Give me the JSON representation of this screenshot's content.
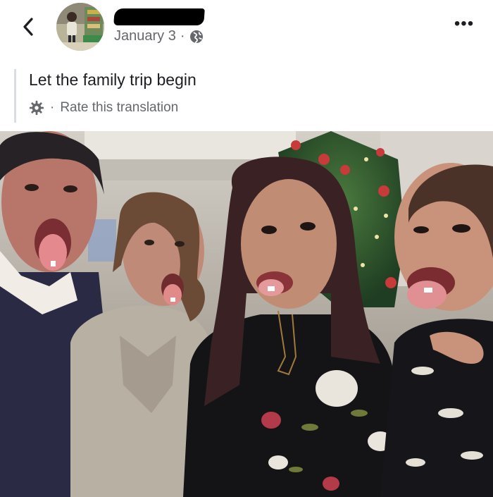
{
  "header": {
    "date": "January 3",
    "separator": "·",
    "privacy_icon": "globe-icon",
    "back_icon": "chevron-left-icon",
    "more_label": "•••"
  },
  "post": {
    "text": "Let the family trip begin",
    "translation": {
      "separator": "·",
      "link_label": "Rate this translation",
      "icon": "gear-icon"
    }
  },
  "photo": {
    "description_free": true
  },
  "colors": {
    "meta_text": "#65676b",
    "body_text": "#1c1e21",
    "quote_border": "#dadde1"
  }
}
